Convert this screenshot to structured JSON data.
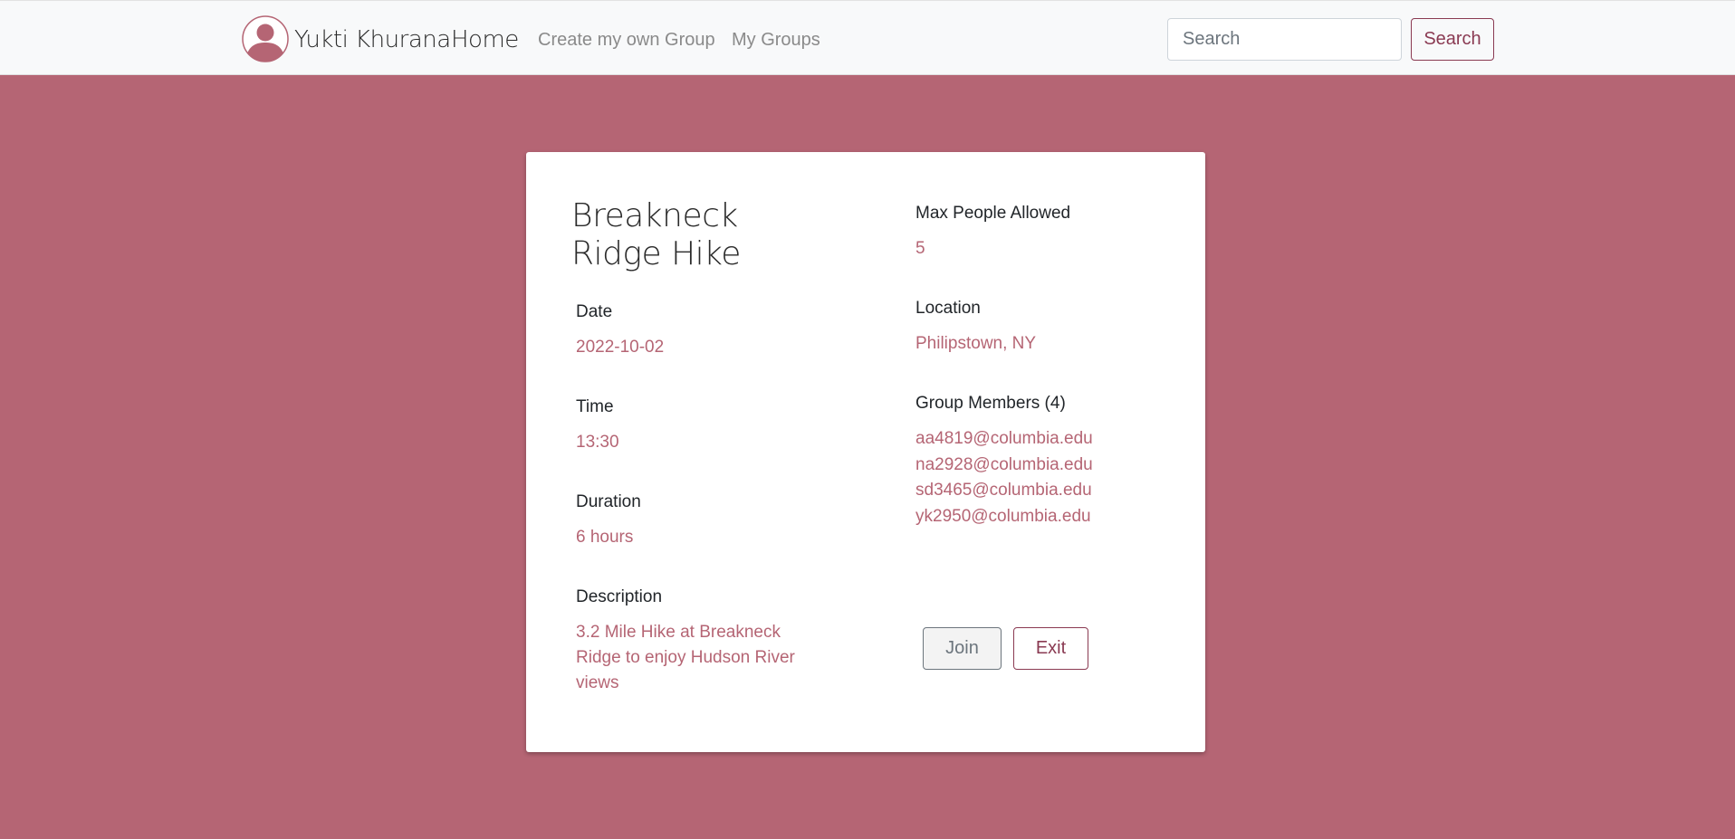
{
  "navbar": {
    "user_name": "Yukti Khurana",
    "home_label": "Home",
    "links": [
      "Create my own Group",
      "My Groups"
    ],
    "search_placeholder": "Search",
    "search_button": "Search"
  },
  "group": {
    "title": "Breakneck Ridge Hike",
    "date_label": "Date",
    "date": "2022-10-02",
    "time_label": "Time",
    "time": "13:30",
    "duration_label": "Duration",
    "duration": "6 hours",
    "description_label": "Description",
    "description": "3.2 Mile Hike at Breakneck Ridge to enjoy Hudson River views",
    "max_label": "Max People Allowed",
    "max_people": "5",
    "location_label": "Location",
    "location": "Philipstown, NY",
    "members_label": "Group Members (4)",
    "members": [
      "aa4819@columbia.edu",
      "na2928@columbia.edu",
      "sd3465@columbia.edu",
      "yk2950@columbia.edu"
    ]
  },
  "actions": {
    "join": "Join",
    "exit": "Exit"
  },
  "colors": {
    "background": "#b56574",
    "accent": "#8a3a52",
    "value_text": "#b56574"
  },
  "icons": {
    "avatar": "user-avatar-icon"
  }
}
